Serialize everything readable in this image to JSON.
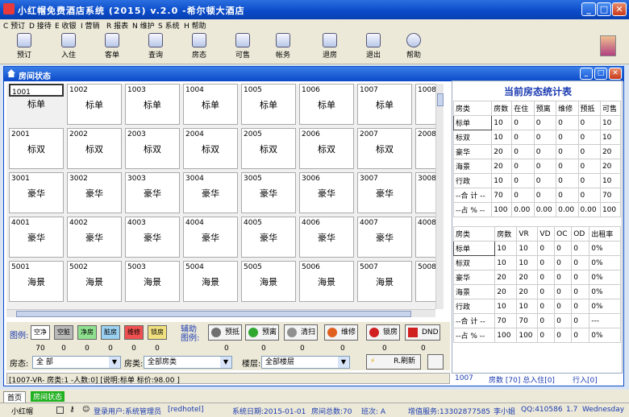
{
  "title": "小红帽免费酒店系统 (2015) v.2.0 -希尔顿大酒店",
  "menu": [
    "C 预订",
    "D 接待",
    "E 收银",
    "I 营销",
    "R 报表",
    "N 维护",
    "S 系统",
    "H 帮助"
  ],
  "toolbar": [
    "预订",
    "入住",
    "客单",
    "查询",
    "房态",
    "可售",
    "帐务",
    "退房",
    "退出",
    "帮助"
  ],
  "inner_title": "房间状态",
  "rooms": [
    [
      {
        "n": "1001",
        "t": "标单"
      },
      {
        "n": "1002",
        "t": "标单"
      },
      {
        "n": "1003",
        "t": "标单"
      },
      {
        "n": "1004",
        "t": "标单"
      },
      {
        "n": "1005",
        "t": "标单"
      },
      {
        "n": "1006",
        "t": "标单"
      },
      {
        "n": "1007",
        "t": "标单"
      },
      {
        "n": "1008",
        "t": ""
      }
    ],
    [
      {
        "n": "2001",
        "t": "标双"
      },
      {
        "n": "2002",
        "t": "标双"
      },
      {
        "n": "2003",
        "t": "标双"
      },
      {
        "n": "2004",
        "t": "标双"
      },
      {
        "n": "2005",
        "t": "标双"
      },
      {
        "n": "2006",
        "t": "标双"
      },
      {
        "n": "2007",
        "t": "标双"
      },
      {
        "n": "2008",
        "t": ""
      }
    ],
    [
      {
        "n": "3001",
        "t": "豪华"
      },
      {
        "n": "3002",
        "t": "豪华"
      },
      {
        "n": "3003",
        "t": "豪华"
      },
      {
        "n": "3004",
        "t": "豪华"
      },
      {
        "n": "3005",
        "t": "豪华"
      },
      {
        "n": "3006",
        "t": "豪华"
      },
      {
        "n": "3007",
        "t": "豪华"
      },
      {
        "n": "3008",
        "t": ""
      }
    ],
    [
      {
        "n": "4001",
        "t": "豪华"
      },
      {
        "n": "4002",
        "t": "豪华"
      },
      {
        "n": "4003",
        "t": "豪华"
      },
      {
        "n": "4004",
        "t": "豪华"
      },
      {
        "n": "4005",
        "t": "豪华"
      },
      {
        "n": "4006",
        "t": "豪华"
      },
      {
        "n": "4007",
        "t": "豪华"
      },
      {
        "n": "4008",
        "t": ""
      }
    ],
    [
      {
        "n": "5001",
        "t": "海景"
      },
      {
        "n": "5002",
        "t": "海景"
      },
      {
        "n": "5003",
        "t": "海景"
      },
      {
        "n": "5004",
        "t": "海景"
      },
      {
        "n": "5005",
        "t": "海景"
      },
      {
        "n": "5006",
        "t": "海景"
      },
      {
        "n": "5007",
        "t": "海景"
      },
      {
        "n": "5008",
        "t": ""
      }
    ]
  ],
  "stats": {
    "title": "当前房态统计表",
    "head1": [
      "房类",
      "房数",
      "在住",
      "预离",
      "维修",
      "预抵",
      "可售"
    ],
    "rows1": [
      [
        "标单",
        "10",
        "0",
        "0",
        "0",
        "0",
        "10"
      ],
      [
        "标双",
        "10",
        "0",
        "0",
        "0",
        "0",
        "10"
      ],
      [
        "豪华",
        "20",
        "0",
        "0",
        "0",
        "0",
        "20"
      ],
      [
        "海景",
        "20",
        "0",
        "0",
        "0",
        "0",
        "20"
      ],
      [
        "行政",
        "10",
        "0",
        "0",
        "0",
        "0",
        "10"
      ],
      [
        "--合 计 --",
        "70",
        "0",
        "0",
        "0",
        "0",
        "70"
      ],
      [
        "--占 % --",
        "100",
        "0.00",
        "0.00",
        "0.00",
        "0.00",
        "100"
      ]
    ],
    "head2": [
      "房类",
      "房数",
      "VR",
      "VD",
      "OC",
      "OD",
      "出租率"
    ],
    "rows2": [
      [
        "标单",
        "10",
        "10",
        "0",
        "0",
        "0",
        "0%"
      ],
      [
        "标双",
        "10",
        "10",
        "0",
        "0",
        "0",
        "0%"
      ],
      [
        "豪华",
        "20",
        "20",
        "0",
        "0",
        "0",
        "0%"
      ],
      [
        "海景",
        "20",
        "20",
        "0",
        "0",
        "0",
        "0%"
      ],
      [
        "行政",
        "10",
        "10",
        "0",
        "0",
        "0",
        "0%"
      ],
      [
        "--合 计 --",
        "70",
        "70",
        "0",
        "0",
        "0",
        "---"
      ],
      [
        "--占 % --",
        "100",
        "100",
        "0",
        "0",
        "0",
        "0%"
      ]
    ]
  },
  "legend_label": "图例:",
  "legend": [
    {
      "label": "空净",
      "color": "#ffffff",
      "count": "70"
    },
    {
      "label": "空脏",
      "color": "#b8b8b8",
      "count": "0"
    },
    {
      "label": "净房",
      "color": "#8ee08e",
      "count": "0"
    },
    {
      "label": "脏房",
      "color": "#9ad0f0",
      "count": "0"
    },
    {
      "label": "维修",
      "color": "#f05050",
      "count": "0"
    },
    {
      "label": "锁房",
      "color": "#f0e080",
      "count": "0"
    }
  ],
  "aux_label": "辅助图例:",
  "aux": [
    {
      "label": "预抵",
      "color": "#707070",
      "count": "0"
    },
    {
      "label": "预离",
      "color": "#30a830",
      "count": "0"
    },
    {
      "label": "清扫",
      "color": "#909090",
      "count": "0"
    },
    {
      "label": "维修",
      "color": "#e06020",
      "count": "0"
    },
    {
      "label": "锁房",
      "color": "#d02020",
      "count": "0"
    },
    {
      "label": "DND",
      "color": "#d02020",
      "count": "0"
    }
  ],
  "filter": {
    "state_label": "房态:",
    "state_value": "全  部",
    "type_label": "房类:",
    "type_value": "全部房类",
    "floor_label": "楼层:",
    "floor_value": "全部楼层",
    "refresh": "R.刷新"
  },
  "istatus": "[1007-VR- 房类:1 -人数:0] [说明:标单     标价:98.00 ]",
  "rstatus": [
    "1007",
    "房数 [70] 总入住[0]",
    "行入[0]"
  ],
  "tabs": [
    "首页",
    "房间状态"
  ],
  "status": {
    "app": "小红帽",
    "user": "登录用户:系统管理员",
    "db": "[redhotel]",
    "date": "系统日期:2015-01-01",
    "rooms": "房间总数:70",
    "shift": "班次: A",
    "service": "增值服务:13302877585",
    "name": "李小姐",
    "qq": "QQ:410586",
    "ver": "1.7",
    "day": "Wednesday"
  }
}
